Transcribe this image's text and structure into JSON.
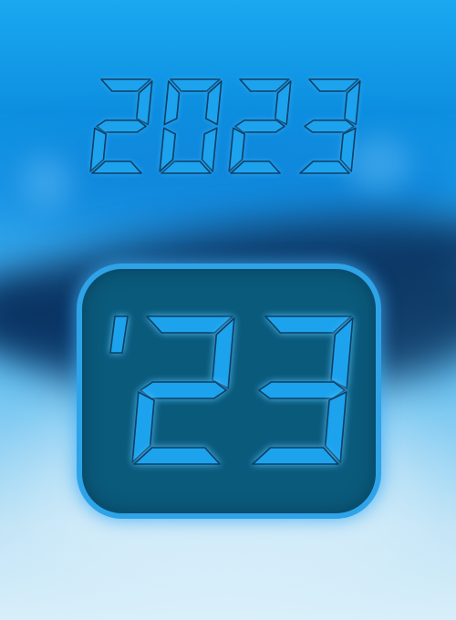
{
  "year": "2023",
  "badge": {
    "apostrophe": "'",
    "digits": "23"
  },
  "colors": {
    "segment_fill": "#1da3ee",
    "segment_outline": "#0b3f66",
    "badge_fill": "#0a5a7c",
    "badge_glow": "#2fa3e8"
  },
  "icons": {
    "segment_style": "seven-segment-display"
  }
}
